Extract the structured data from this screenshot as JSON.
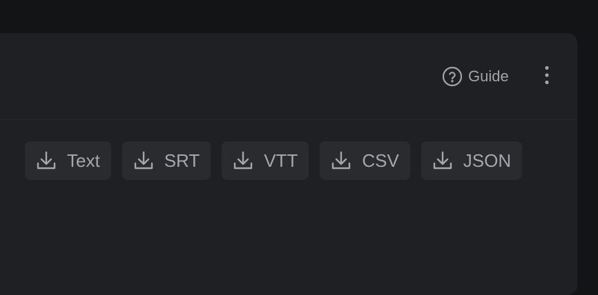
{
  "header": {
    "guide_label": "Guide",
    "guide_icon": "help-circle-icon",
    "more_icon": "more-vertical-icon"
  },
  "exports": [
    {
      "label": "Text",
      "icon": "download-icon"
    },
    {
      "label": "SRT",
      "icon": "download-icon"
    },
    {
      "label": "VTT",
      "icon": "download-icon"
    },
    {
      "label": "CSV",
      "icon": "download-icon"
    },
    {
      "label": "JSON",
      "icon": "download-icon"
    }
  ],
  "colors": {
    "page_background": "#131416",
    "panel_background": "#1f2023",
    "button_background": "#2a2b2f",
    "text": "#a5a7ae"
  }
}
